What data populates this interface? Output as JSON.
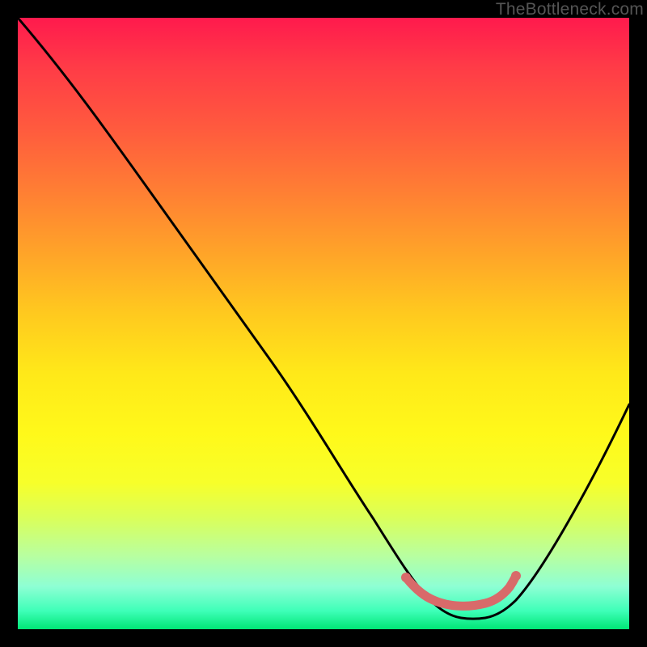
{
  "watermark": "TheBottleneck.com",
  "chart_data": {
    "type": "line",
    "title": "",
    "xlabel": "",
    "ylabel": "",
    "xlim": [
      0,
      100
    ],
    "ylim": [
      0,
      100
    ],
    "grid": false,
    "legend": false,
    "annotations": [],
    "series": [
      {
        "name": "bottleneck-curve",
        "color": "#000000",
        "x": [
          0,
          5,
          10,
          15,
          20,
          25,
          30,
          35,
          40,
          45,
          50,
          55,
          60,
          63,
          66,
          68,
          70,
          72,
          74,
          76,
          78,
          80,
          82,
          85,
          88,
          92,
          96,
          100
        ],
        "y": [
          100,
          94,
          88,
          82,
          75,
          68,
          61,
          54,
          47,
          40,
          33,
          26,
          19,
          14,
          10,
          7,
          5,
          4,
          3,
          3,
          3,
          4,
          6,
          10,
          16,
          25,
          35,
          46
        ]
      },
      {
        "name": "optimal-range-marker",
        "color": "#d86a6a",
        "x": [
          63,
          65,
          67,
          69,
          71,
          73,
          75,
          77,
          79,
          80
        ],
        "y": [
          8.5,
          7.5,
          6.8,
          6.3,
          6.0,
          6.0,
          6.0,
          6.3,
          7.0,
          8.2
        ]
      }
    ],
    "background_gradient": {
      "top": "#ff1a4d",
      "middle": "#ffe819",
      "bottom": "#00e676"
    }
  }
}
